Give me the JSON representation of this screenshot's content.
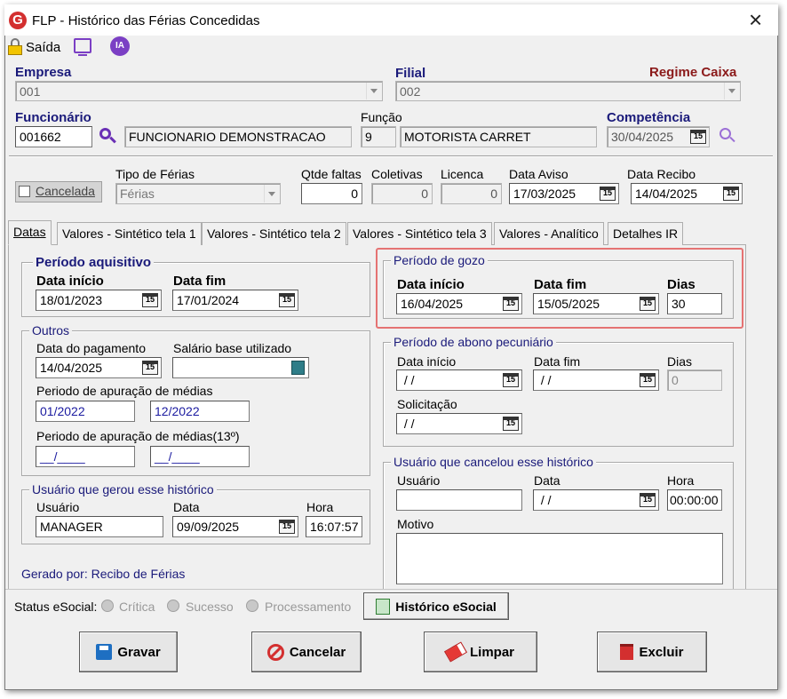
{
  "window": {
    "title": "FLP - Histórico das Férias Concedidas",
    "close": "×"
  },
  "toolbar": {
    "exit": "Saída",
    "ia": "IA"
  },
  "header": {
    "empresa_label": "Empresa",
    "empresa_value": "001",
    "filial_label": "Filial",
    "filial_value": "002",
    "regime": "Regime Caixa",
    "funcionario_label": "Funcionário",
    "funcionario_code": "001662",
    "funcionario_name": "FUNCIONARIO DEMONSTRACAO",
    "funcao_label": "Função",
    "funcao_code": "9",
    "funcao_name": "MOTORISTA CARRET",
    "competencia_label": "Competência",
    "competencia_value": "30/04/2025"
  },
  "row2": {
    "cancelada": "Cancelada",
    "tipo_label": "Tipo de Férias",
    "tipo_value": "Férias",
    "qtde_label": "Qtde faltas",
    "qtde_value": "0",
    "coletivas_label": "Coletivas",
    "coletivas_value": "0",
    "licenca_label": "Licenca",
    "licenca_value": "0",
    "aviso_label": "Data Aviso",
    "aviso_value": "17/03/2025",
    "recibo_label": "Data Recibo",
    "recibo_value": "14/04/2025"
  },
  "tabs": [
    "Datas",
    "Valores - Sintético tela 1",
    "Valores - Sintético tela 2",
    "Valores - Sintético tela 3",
    "Valores - Analítico",
    "Detalhes IR"
  ],
  "aquisitivo": {
    "title": "Período aquisitivo",
    "inicio_label": "Data início",
    "inicio": "18/01/2023",
    "fim_label": "Data fim",
    "fim": "17/01/2024"
  },
  "outros": {
    "title": "Outros",
    "pagamento_label": "Data do pagamento",
    "pagamento": "14/04/2025",
    "salario_label": "Salário base utilizado",
    "salario": "",
    "apuracao_label": "Periodo de apuração de médias",
    "apuracao_ini": "01/2022",
    "apuracao_fim": "12/2022",
    "apuracao13_label": "Periodo de apuração de médias(13º)",
    "apuracao13_ini": "__/____",
    "apuracao13_fim": "__/____"
  },
  "gerou": {
    "title": "Usuário que gerou esse histórico",
    "usuario_label": "Usuário",
    "usuario": "MANAGER",
    "data_label": "Data",
    "data": "09/09/2025",
    "hora_label": "Hora",
    "hora": "16:07:57"
  },
  "gerado_por": "Gerado por: Recibo de Férias",
  "gozo": {
    "title": "Período de gozo",
    "inicio_label": "Data início",
    "inicio": "16/04/2025",
    "fim_label": "Data fim",
    "fim": "15/05/2025",
    "dias_label": "Dias",
    "dias": "30"
  },
  "abono": {
    "title": "Período de abono pecuniário",
    "inicio_label": "Data início",
    "inicio": " / /",
    "fim_label": "Data fim",
    "fim": " / /",
    "dias_label": "Dias",
    "dias": "0",
    "solic_label": "Solicitação",
    "solic": " / /"
  },
  "cancelou": {
    "title": "Usuário que cancelou esse histórico",
    "usuario_label": "Usuário",
    "usuario": "",
    "data_label": "Data",
    "data": " / /",
    "hora_label": "Hora",
    "hora": "00:00:00",
    "motivo_label": "Motivo",
    "motivo": ""
  },
  "status": {
    "label": "Status eSocial:",
    "critica": "Crítica",
    "sucesso": "Sucesso",
    "processamento": "Processamento",
    "historico": "Histórico eSocial"
  },
  "buttons": {
    "gravar": "Gravar",
    "cancelar": "Cancelar",
    "limpar": "Limpar",
    "excluir": "Excluir"
  },
  "colors": {
    "navy": "#1a1a7a",
    "regime": "#8b1a1a",
    "highlight": "#e57373",
    "icon_purple": "#7b3fc4"
  }
}
